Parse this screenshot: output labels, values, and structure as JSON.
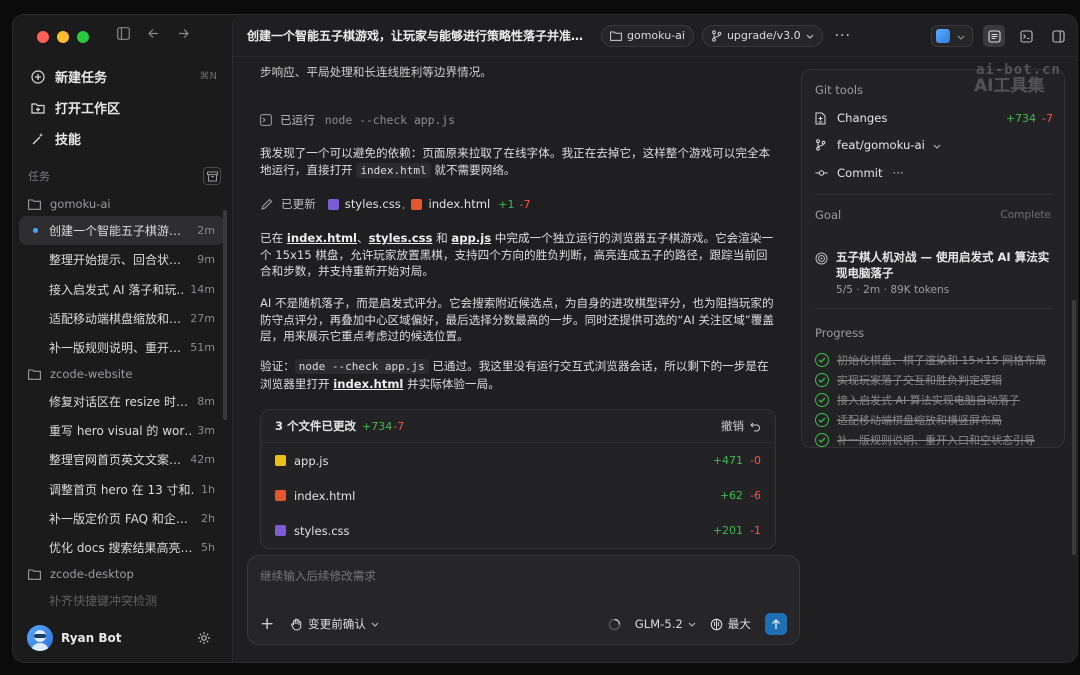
{
  "sidebar": {
    "nav": [
      {
        "label": "新建任务",
        "shortcut": "⌘N"
      },
      {
        "label": "打开工作区"
      },
      {
        "label": "技能"
      }
    ],
    "section_label": "任务",
    "groups": [
      {
        "name": "gomoku-ai",
        "tasks": [
          {
            "title": "创建一个智能五子棋游…",
            "time": "2m"
          },
          {
            "title": "整理开始提示、回合状…",
            "time": "9m"
          },
          {
            "title": "接入启发式 AI 落子和玩…",
            "time": "14m"
          },
          {
            "title": "适配移动端棋盘缩放和…",
            "time": "27m"
          },
          {
            "title": "补一版规则说明、重开…",
            "time": "51m"
          }
        ]
      },
      {
        "name": "zcode-website",
        "tasks": [
          {
            "title": "修复对话区在 resize 时…",
            "time": "8m"
          },
          {
            "title": "重写 hero visual 的 wor…",
            "time": "3m"
          },
          {
            "title": "整理官网首页英文文案…",
            "time": "42m"
          },
          {
            "title": "调整首页 hero 在 13 寸和…",
            "time": "1h"
          },
          {
            "title": "补一版定价页 FAQ 和企…",
            "time": "2h"
          },
          {
            "title": "优化 docs 搜索结果高亮…",
            "time": "5h"
          }
        ]
      },
      {
        "name": "zcode-desktop",
        "tasks": [
          {
            "title": "补齐快捷键冲突检测",
            "time": ""
          }
        ]
      }
    ],
    "user": {
      "name": "Ryan Bot"
    }
  },
  "topbar": {
    "title": "创建一个智能五子棋游戏，让玩家与能够进行策略性落子并准确判断…",
    "repo": "gomoku-ai",
    "branch": "upgrade/v3.0",
    "more": "···"
  },
  "messages": {
    "m0": "步响应、平局处理和长连线胜利等边界情况。",
    "ran_label": "已运行",
    "ran_cmd": "node --check app.js",
    "m1_a": "我发现了一个可以避免的依赖：页面原来拉取了在线字体。我正在去掉它，这样整个游戏可以完全本地运行，直接打开 ",
    "m1_code": "index.html",
    "m1_b": " 就不需要网络。",
    "updated_label": "已更新",
    "updated_file1": "styles.css",
    "updated_sep": ",",
    "updated_file2": "index.html",
    "updated_add": "+1",
    "updated_del": "-7",
    "m2_pre": "已在 ",
    "m2_link1": "index.html",
    "m2_sep1": "、",
    "m2_link2": "styles.css",
    "m2_and": " 和 ",
    "m2_link3": "app.js",
    "m2_rest": " 中完成一个独立运行的浏览器五子棋游戏。它会渲染一个 15x15 棋盘，允许玩家放置黑棋，支持四个方向的胜负判断，高亮连成五子的路径，跟踪当前回合和步数，并支持重新开始对局。",
    "m3": "AI 不是随机落子，而是启发式评分。它会搜索附近候选点，为自身的进攻棋型评分，也为阻挡玩家的防守点评分，再叠加中心区域偏好，最后选择分数最高的一步。同时还提供可选的“AI 关注区域”覆盖层，用来展示它重点考虑过的候选位置。",
    "m4_pre": "验证：",
    "m4_code": "node --check app.js",
    "m4_mid": " 已通过。我这里没有运行交互式浏览器会话，所以剩下的一步是在浏览器里打开 ",
    "m4_link": "index.html",
    "m4_post": " 并实际体验一局。"
  },
  "changes": {
    "title": "3 个文件已更改",
    "add": "+734",
    "del": "-7",
    "undo": "撤销",
    "files": [
      {
        "name": "app.js",
        "add": "+471",
        "del": "-0",
        "type": "js"
      },
      {
        "name": "index.html",
        "add": "+62",
        "del": "-6",
        "type": "html"
      },
      {
        "name": "styles.css",
        "add": "+201",
        "del": "-1",
        "type": "css"
      }
    ]
  },
  "composer": {
    "placeholder": "继续输入后续修改需求",
    "confirm": "变更前确认",
    "model": "GLM-5.2",
    "effort": "最大"
  },
  "panel": {
    "git_title": "Git tools",
    "changes_label": "Changes",
    "changes_add": "+734",
    "changes_del": "-7",
    "branch": "feat/gomoku-ai",
    "commit": "Commit",
    "commit_more": "···",
    "goal_title": "Goal",
    "goal_status": "Complete",
    "goal_name": "五子棋人机对战 — 使用启发式 AI 算法实现电脑落子",
    "goal_meta": "5/5 · 2m · 89K tokens",
    "progress_title": "Progress",
    "progress": [
      "初始化棋盘、棋子渲染和 15×15 网格布局",
      "实现玩家落子交互和胜负判定逻辑",
      "接入启发式 AI 算法实现电脑自动落子",
      "适配移动端棋盘缩放和横竖屏布局",
      "补一版规则说明、重开入口和空状态引导"
    ]
  },
  "watermark": {
    "line1": "ai-bot.cn",
    "line2": "AI工具集"
  },
  "colors": {
    "accent": "#4aa3ff",
    "add": "#3fb950",
    "del": "#f85149",
    "send": "#1f6fb5"
  }
}
